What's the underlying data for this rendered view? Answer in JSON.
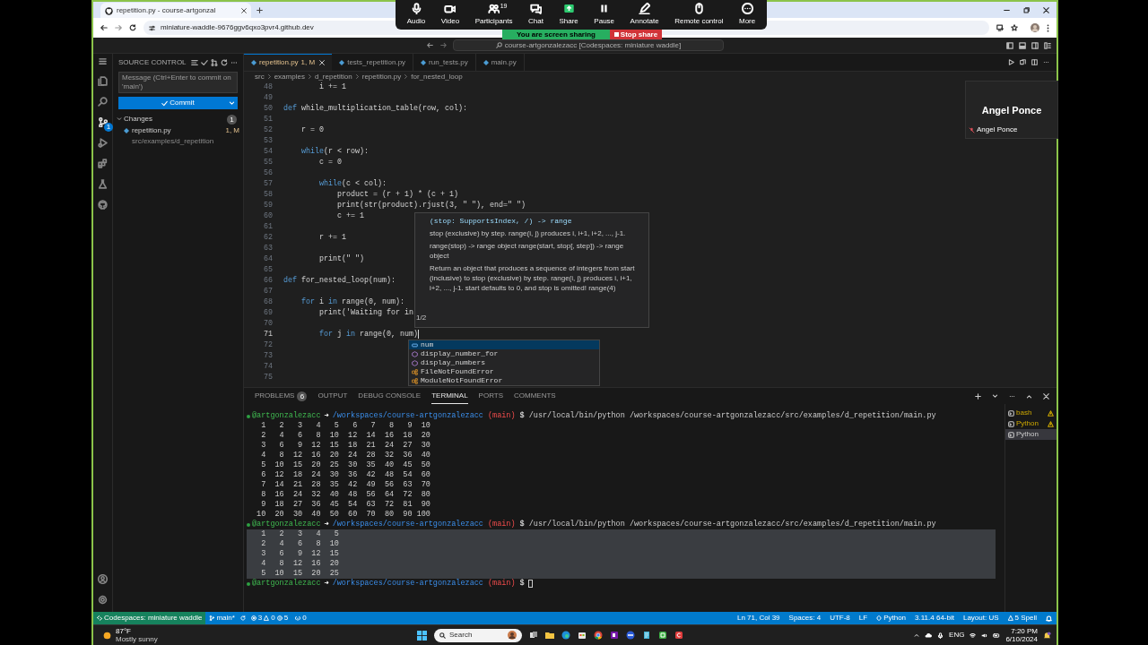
{
  "browser": {
    "tab_title": "repetition.py - course-artgonzal",
    "url": "miniature-waddle-9676ggv6qxo3pvr4.github.dev"
  },
  "meeting": {
    "controls": [
      {
        "label": "Audio",
        "kind": "mic"
      },
      {
        "label": "Video",
        "kind": "video"
      },
      {
        "label": "Participants",
        "kind": "participants",
        "count": "19"
      },
      {
        "label": "Chat",
        "kind": "chat"
      },
      {
        "label": "Share",
        "kind": "share"
      },
      {
        "label": "Pause",
        "kind": "pause"
      },
      {
        "label": "Annotate",
        "kind": "annotate"
      },
      {
        "label": "Remote control",
        "kind": "mouse"
      },
      {
        "label": "More",
        "kind": "more"
      }
    ],
    "sharing_banner": "You are screen sharing",
    "stop_button": "Stop share",
    "participant": {
      "name": "Angel Ponce",
      "caption": "Angel Ponce"
    }
  },
  "title_bar": {
    "command_center": "course-artgonzalezacc [Codespaces: miniature waddle]"
  },
  "activity_bar": [
    {
      "kind": "explorer",
      "selected": false
    },
    {
      "kind": "search",
      "selected": false
    },
    {
      "kind": "source_control",
      "selected": true,
      "badge": "1"
    },
    {
      "kind": "run",
      "selected": false
    },
    {
      "kind": "extensions",
      "selected": false
    },
    {
      "kind": "testing",
      "selected": false
    },
    {
      "kind": "github",
      "selected": false
    }
  ],
  "sidebar": {
    "title": "SOURCE CONTROL",
    "message_placeholder": "Message (Ctrl+Enter to commit on 'main')",
    "commit_button": "Commit",
    "changes": {
      "label": "Changes",
      "count": "1",
      "expanded": true,
      "files": [
        {
          "name": "repetition.py",
          "path": "src/examples/d_repetition",
          "status": "1, M"
        }
      ]
    }
  },
  "editor": {
    "tabs": [
      {
        "label": "repetition.py",
        "status": "1, M",
        "selected": true
      },
      {
        "label": "tests_repetition.py",
        "selected": false
      },
      {
        "label": "run_tests.py",
        "selected": false
      },
      {
        "label": "main.py",
        "selected": false
      }
    ],
    "breadcrumbs": [
      "src",
      "examples",
      "d_repetition",
      "repetition.py",
      "for_nested_loop"
    ],
    "lines": [
      {
        "number": "48",
        "active": false,
        "segments": [
          {
            "text": "        i += 1",
            "kind": "text"
          }
        ]
      },
      {
        "number": "49",
        "active": false
      },
      {
        "number": "50",
        "active": false,
        "segments": [
          {
            "text": "def",
            "kind": "keyword"
          },
          {
            "text": " while_multiplication_table(row, col):",
            "kind": "text"
          }
        ]
      },
      {
        "number": "51",
        "active": false
      },
      {
        "number": "52",
        "active": false,
        "segments": [
          {
            "text": "    r = 0",
            "kind": "text"
          }
        ]
      },
      {
        "number": "53",
        "active": false
      },
      {
        "number": "54",
        "active": false,
        "segments": [
          {
            "text": "    while",
            "kind": "keyword"
          },
          {
            "text": "(r < row):",
            "kind": "text"
          }
        ]
      },
      {
        "number": "55",
        "active": false,
        "segments": [
          {
            "text": "        c = 0",
            "kind": "text"
          }
        ]
      },
      {
        "number": "56",
        "active": false
      },
      {
        "number": "57",
        "active": false,
        "segments": [
          {
            "text": "        while",
            "kind": "keyword"
          },
          {
            "text": "(c < col):",
            "kind": "text"
          }
        ]
      },
      {
        "number": "58",
        "active": false,
        "segments": [
          {
            "text": "            product = (r + 1) * (c + 1)",
            "kind": "text"
          }
        ]
      },
      {
        "number": "59",
        "active": false,
        "segments": [
          {
            "text": "            print(str(product).rjust(3, \" \"), end=\" \")",
            "kind": "text"
          }
        ]
      },
      {
        "number": "60",
        "active": false,
        "segments": [
          {
            "text": "            c += 1",
            "kind": "text"
          }
        ]
      },
      {
        "number": "61",
        "active": false
      },
      {
        "number": "62",
        "active": false,
        "segments": [
          {
            "text": "        r += 1",
            "kind": "text"
          }
        ]
      },
      {
        "number": "63",
        "active": false
      },
      {
        "number": "64",
        "active": false,
        "segments": [
          {
            "text": "        print(\" \")",
            "kind": "text"
          }
        ]
      },
      {
        "number": "65",
        "active": false
      },
      {
        "number": "66",
        "active": false,
        "segments": [
          {
            "text": "def",
            "kind": "keyword"
          },
          {
            "text": " for_nested_loop(num):",
            "kind": "text"
          }
        ]
      },
      {
        "number": "67",
        "active": false
      },
      {
        "number": "68",
        "active": false,
        "segments": [
          {
            "text": "    for",
            "kind": "keyword"
          },
          {
            "text": " i ",
            "kind": "text"
          },
          {
            "text": "in",
            "kind": "keyword"
          },
          {
            "text": " range(0, num):",
            "kind": "text"
          }
        ]
      },
      {
        "number": "69",
        "active": false,
        "segments": [
          {
            "text": "        print('Waiting for in",
            "kind": "text"
          }
        ]
      },
      {
        "number": "70",
        "active": false
      },
      {
        "number": "71",
        "active": true,
        "segments": [
          {
            "text": "        for",
            "kind": "keyword"
          },
          {
            "text": " j ",
            "kind": "text"
          },
          {
            "text": "in",
            "kind": "keyword"
          },
          {
            "text": " range(0, num)",
            "kind": "text"
          }
        ]
      },
      {
        "number": "72",
        "active": false
      },
      {
        "number": "73",
        "active": false
      },
      {
        "number": "74",
        "active": false
      },
      {
        "number": "75",
        "active": false
      }
    ],
    "hover": {
      "signature": "(stop: SupportsIndex, /) -> range",
      "counter": "1/2",
      "paragraphs": [
        "stop (exclusive) by step. range(i, j) produces i, i+1, i+2, ..., j-1.",
        "range(stop) -> range object range(start, stop[, step]) -> range object",
        "Return an object that produces a sequence of integers from start (inclusive) to stop (exclusive) by step. range(i, j) produces i, i+1, i+2, ..., j-1. start defaults to 0, and stop is omitted! range(4)"
      ]
    },
    "suggestions": [
      {
        "label": "num",
        "kind": "variable",
        "selected": true
      },
      {
        "label": "display_number_for",
        "kind": "function",
        "selected": false
      },
      {
        "label": "display_numbers",
        "kind": "function",
        "selected": false
      },
      {
        "label": "FileNotFoundError",
        "kind": "class",
        "selected": false
      },
      {
        "label": "ModuleNotFoundError",
        "kind": "class",
        "selected": false
      }
    ]
  },
  "panel": {
    "tabs": [
      {
        "label": "PROBLEMS",
        "badge": "6",
        "selected": false
      },
      {
        "label": "OUTPUT",
        "selected": false
      },
      {
        "label": "DEBUG CONSOLE",
        "selected": false
      },
      {
        "label": "TERMINAL",
        "selected": true
      },
      {
        "label": "PORTS",
        "selected": false
      },
      {
        "label": "COMMENTS",
        "selected": false
      }
    ],
    "terminal": [
      {
        "user": "@artgonzalezacc",
        "arrow": "➜",
        "cwd": "/workspaces/course-artgonzalezacc",
        "branch": "(main)",
        "symbol": "$",
        "command": "/usr/local/bin/python /workspaces/course-artgonzalezacc/src/examples/d_repetition/main.py",
        "cursor": false,
        "selected": false,
        "output": [
          "  1   2   3   4   5   6   7   8   9  10",
          "  2   4   6   8  10  12  14  16  18  20",
          "  3   6   9  12  15  18  21  24  27  30",
          "  4   8  12  16  20  24  28  32  36  40",
          "  5  10  15  20  25  30  35  40  45  50",
          "  6  12  18  24  30  36  42  48  54  60",
          "  7  14  21  28  35  42  49  56  63  70",
          "  8  16  24  32  40  48  56  64  72  80",
          "  9  18  27  36  45  54  63  72  81  90",
          " 10  20  30  40  50  60  70  80  90 100"
        ]
      },
      {
        "user": "@artgonzalezacc",
        "arrow": "➜",
        "cwd": "/workspaces/course-artgonzalezacc",
        "branch": "(main)",
        "symbol": "$",
        "command": "/usr/local/bin/python /workspaces/course-artgonzalezacc/src/examples/d_repetition/main.py",
        "cursor": false,
        "selected": true,
        "output": [
          "  1   2   3   4   5",
          "  2   4   6   8  10",
          "  3   6   9  12  15",
          "  4   8  12  16  20",
          "  5  10  15  20  25"
        ]
      },
      {
        "user": "@artgonzalezacc",
        "arrow": "➜",
        "cwd": "/workspaces/course-artgonzalezacc",
        "branch": "(main)",
        "symbol": "$",
        "cursor": true,
        "selected": false
      }
    ],
    "terminals": [
      {
        "label": "bash",
        "warning": true,
        "selected": false
      },
      {
        "label": "Python",
        "warning": true,
        "selected": false
      },
      {
        "label": "Python",
        "warning": false,
        "selected": true
      }
    ]
  },
  "status_bar": {
    "remote": "Codespaces: miniature waddle",
    "branch": "main*",
    "errors": "3",
    "warnings": "0",
    "infos": "5",
    "ports": "0",
    "right": [
      {
        "text": "Ln 71, Col 39",
        "kind": "plain"
      },
      {
        "text": "Spaces: 4",
        "kind": "plain"
      },
      {
        "text": "UTF-8",
        "kind": "plain"
      },
      {
        "text": "LF",
        "kind": "plain"
      },
      {
        "text": "Python",
        "kind": "language"
      },
      {
        "text": "3.11.4 64-bit",
        "kind": "plain"
      },
      {
        "text": "Layout: US",
        "kind": "plain"
      },
      {
        "text": "5 Spell",
        "kind": "warning"
      }
    ]
  },
  "taskbar": {
    "temperature": "87°F",
    "condition": "Mostly sunny",
    "search": "Search",
    "language": "ENG",
    "time": "7:20 PM",
    "date": "6/10/2024"
  }
}
